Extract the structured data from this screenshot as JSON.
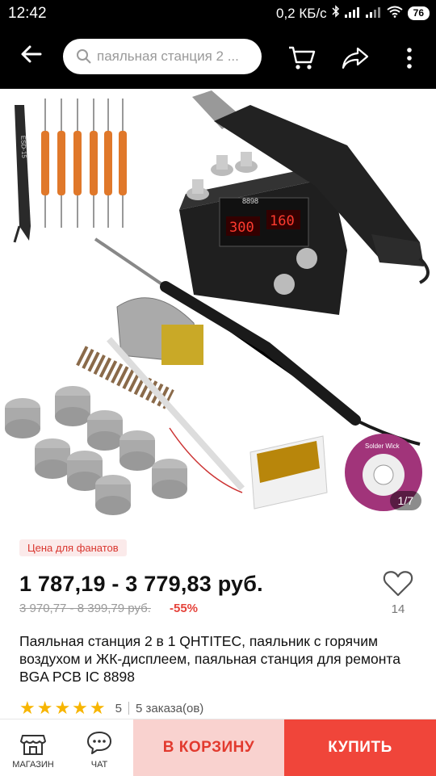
{
  "status_bar": {
    "time": "12:42",
    "net_speed": "0,2 КБ/с",
    "battery": "76"
  },
  "search": {
    "placeholder": "паяльная станция 2 ..."
  },
  "gallery": {
    "page_indicator": "1/7"
  },
  "product": {
    "fan_badge": "Цена для фанатов",
    "price": "1 787,19 - 3 779,83 руб.",
    "old_price": "3 970,77 - 8 399,79 руб.",
    "discount": "-55%",
    "wishlist_count": "14",
    "title": "Паяльная станция 2 в 1 QHTITEC, паяльник с горячим воздухом и ЖК-дисплеем, паяльная станция для ремонта BGA PCB IC 8898",
    "rating_value": "5",
    "orders": "5 заказа(ов)",
    "stars": "★★★★★",
    "display_left": "300",
    "display_right": "160",
    "model": "8898",
    "solder_wick": "Solder Wick",
    "tweezers_label": "ESD-15"
  },
  "bottom_bar": {
    "store_label": "МАГАЗИН",
    "chat_label": "ЧАТ",
    "cart_label": "В КОРЗИНУ",
    "buy_label": "КУПИТЬ"
  },
  "colors": {
    "accent": "#f0453a",
    "cart_bg": "#f9d2cf",
    "star": "#f7b500"
  }
}
